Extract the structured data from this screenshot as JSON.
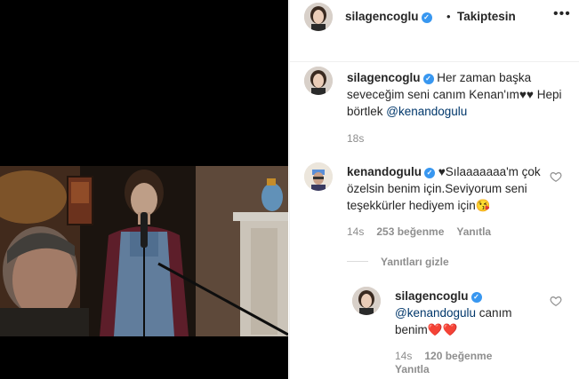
{
  "post": {
    "username": "silagencoglu",
    "follow_status": "Takiptesin",
    "more_icon": "more-horizontal-icon"
  },
  "caption": {
    "username": "silagencoglu",
    "text": "Her zaman başka seveceğim seni canım Kenan'ım♥♥ Hepi börtlek ",
    "mention": "@kenandogulu",
    "time": "18s"
  },
  "comments": [
    {
      "username": "kenandogulu",
      "text": "♥Sılaaaaaaa'm çok özelsin benim için.Seviyorum seni teşekkürler hediyem için😘",
      "time": "14s",
      "likes": "253 beğenme",
      "reply_label": "Yanıtla",
      "hide_replies_label": "Yanıtları gizle",
      "replies": [
        {
          "username": "silagencoglu",
          "mention": "@kenandogulu",
          "text": " canım benim",
          "hearts": "❤️❤️",
          "time": "14s",
          "likes": "120 beğenme",
          "reply_label": "Yanıtla"
        }
      ]
    }
  ],
  "colors": {
    "verified": "#3897f0",
    "mention": "#00376b",
    "meta": "#8e8e8e",
    "heart": "#ed4956"
  }
}
